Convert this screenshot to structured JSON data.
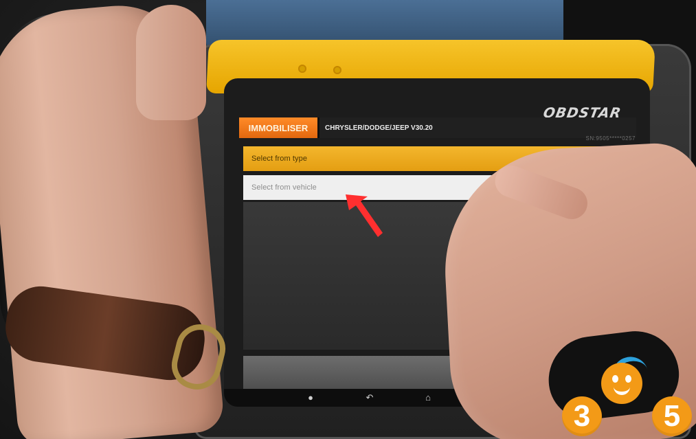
{
  "brand": {
    "logo_text": "OBDSTAR",
    "serial_number": "SN:9505*****0257"
  },
  "screen": {
    "module_tab": "IMMOBILISER",
    "vehicle_path": "CHRYSLER/DODGE/JEEP  V30.20"
  },
  "menu": {
    "items": [
      {
        "label": "Select from type",
        "state": "selected"
      },
      {
        "label": "Select from vehicle",
        "state": "default"
      }
    ]
  },
  "navigation": {
    "icons": [
      "back-home-icon",
      "back-icon",
      "home-icon",
      "recent-apps-icon"
    ]
  },
  "watermark": {
    "text": "365"
  },
  "colors": {
    "accent": "#f39a17",
    "selected_row": "#f3b62d",
    "tab": "#ff8b28",
    "arrow": "#ff2f2f"
  }
}
